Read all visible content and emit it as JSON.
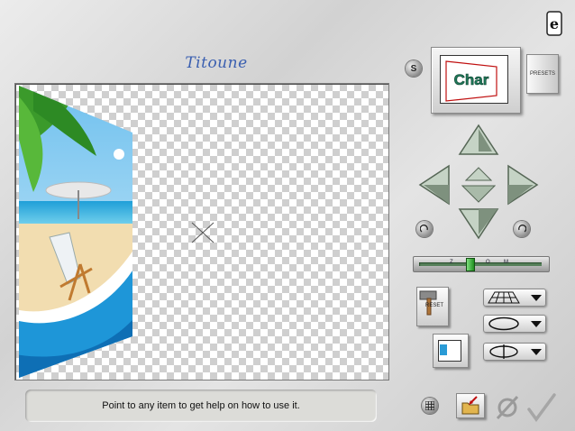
{
  "app": {
    "title": "Titoune",
    "logo_letter": "e"
  },
  "help_text": "Point to any item to get help on how to use it.",
  "preview": {
    "text": "Char",
    "s_button": "S",
    "presets_label": "PRESETS"
  },
  "slider": {
    "labels": [
      "Z",
      "O",
      "M"
    ],
    "value": 0.42
  },
  "buttons": {
    "reset_label": "RESET"
  },
  "colors": {
    "accent": "#3a5fb0",
    "arrow_fill": "#b8c9b8",
    "slider_green": "#2fb52f"
  },
  "icons": {
    "up": "arrow-up-icon",
    "down": "arrow-down-icon",
    "left": "arrow-left-icon",
    "right": "arrow-right-icon",
    "ok": "checkmark-icon",
    "cancel": "cancel-icon"
  }
}
